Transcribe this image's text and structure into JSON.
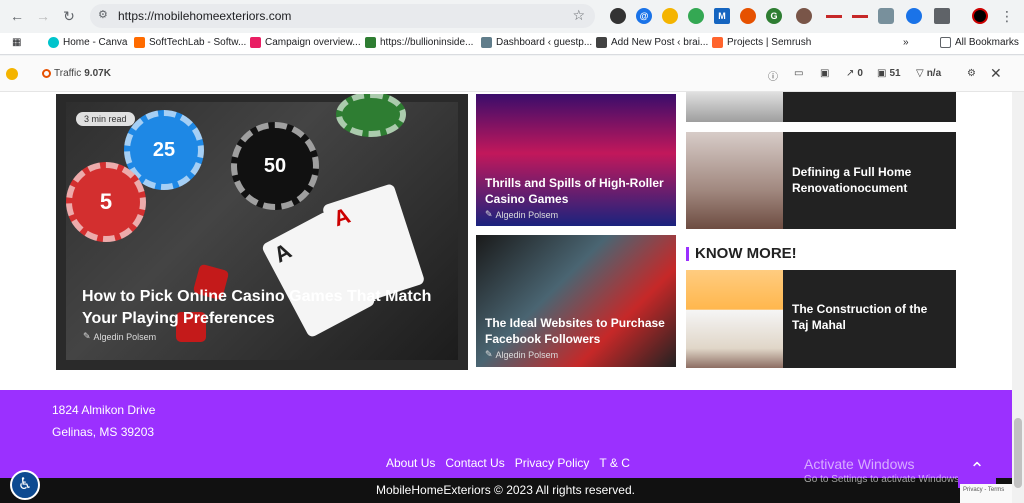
{
  "browser": {
    "url": "https://mobilehomeexteriors.com",
    "bookmarks": [
      {
        "label": "Home - Canva",
        "color": "#00c4cc"
      },
      {
        "label": "SoftTechLab - Softw...",
        "color": "#ff6b00"
      },
      {
        "label": "Campaign overview...",
        "color": "#e91e63"
      },
      {
        "label": "https://bullioninside...",
        "color": "#2e7d32"
      },
      {
        "label": "Dashboard ‹ guestp...",
        "color": "#607d8b"
      },
      {
        "label": "Add New Post ‹ brai...",
        "color": "#424242"
      },
      {
        "label": "Projects | Semrush",
        "color": "#ff642d"
      }
    ],
    "all_bookmarks": "All Bookmarks"
  },
  "extension_bar": {
    "traffic_label": "Traffic",
    "traffic_value": "9.07K",
    "backlinks": "0",
    "pages": "51",
    "rating": "n/a"
  },
  "featured": {
    "read_time": "3 min read",
    "title": "How to Pick Online Casino Games That Match Your Playing Preferences",
    "author": "Algedin Polsem",
    "chips": [
      "25",
      "50",
      "5"
    ],
    "cards": [
      "A",
      "A"
    ]
  },
  "mid_posts": [
    {
      "title": "Thrills and Spills of High-Roller Casino Games",
      "author": "Algedin Polsem"
    },
    {
      "title": "The Ideal Websites to Purchase Facebook Followers",
      "author": "Algedin Polsem"
    }
  ],
  "right_posts": [
    {
      "title": "Defining a Full Home Renovationocument"
    },
    {
      "title": "The Construction of the Taj Mahal"
    }
  ],
  "know_more": "KNOW MORE!",
  "footer": {
    "address_line1": "1824 Almikon Drive",
    "address_line2": "Gelinas, MS 39203",
    "links": [
      "About Us",
      "Contact Us",
      "Privacy Policy",
      "T & C"
    ],
    "copyright": "MobileHomeExteriors © 2023 All rights reserved."
  },
  "watermark": {
    "line1": "Activate Windows",
    "line2": "Go to Settings to activate Windows."
  },
  "recaptcha": "Privacy - Terms",
  "colors": {
    "accent": "#9b30ff",
    "dark": "#222222"
  }
}
